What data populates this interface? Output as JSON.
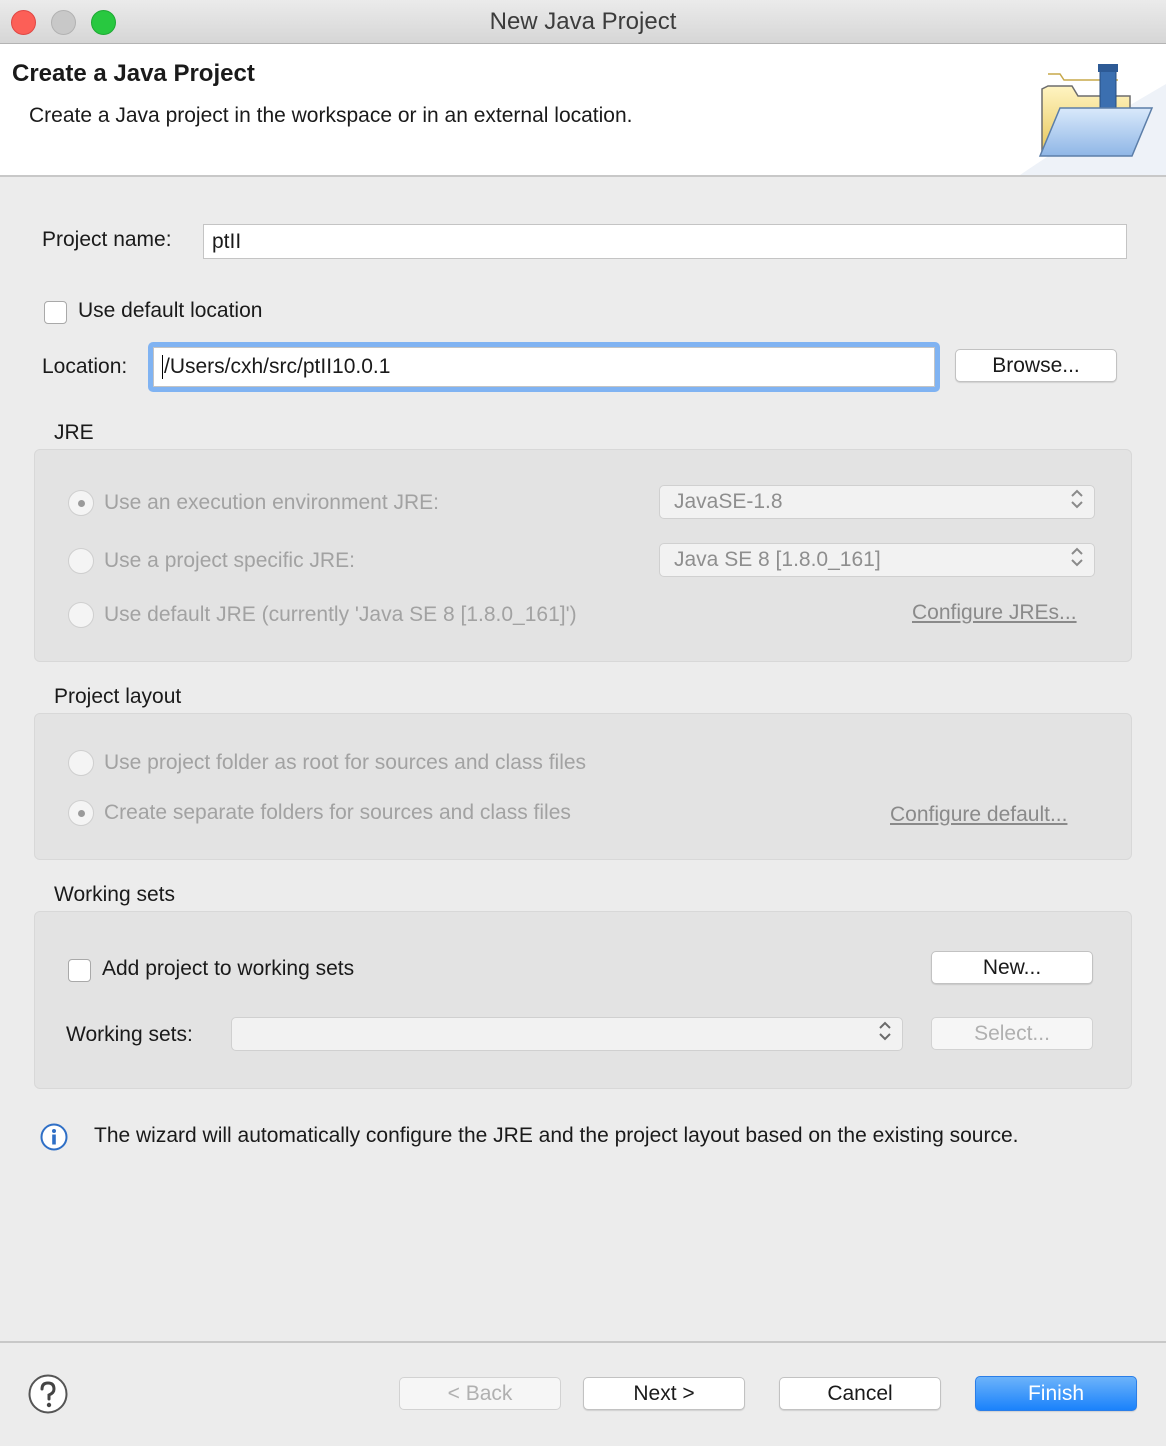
{
  "window": {
    "title": "New Java Project"
  },
  "header": {
    "title": "Create a Java Project",
    "description": "Create a Java project in the workspace or in an external location."
  },
  "project_name": {
    "label": "Project name:",
    "value": "ptII"
  },
  "default_location": {
    "label": "Use default location",
    "checked": false
  },
  "location": {
    "label": "Location:",
    "value": "/Users/cxh/src/ptII10.0.1",
    "browse_label": "Browse..."
  },
  "jre": {
    "group_label": "JRE",
    "option_env": "Use an execution environment JRE:",
    "option_specific": "Use a project specific JRE:",
    "option_default": "Use default JRE (currently 'Java SE 8 [1.8.0_161]')",
    "env_select": "JavaSE-1.8",
    "specific_select": "Java SE 8 [1.8.0_161]",
    "configure_link": "Configure JREs...",
    "selected": "option_env"
  },
  "layout": {
    "group_label": "Project layout",
    "option_root": "Use project folder as root for sources and class files",
    "option_separate": "Create separate folders for sources and class files",
    "configure_link": "Configure default...",
    "selected": "option_separate"
  },
  "working_sets": {
    "group_label": "Working sets",
    "add_label": "Add project to working sets",
    "add_checked": false,
    "new_button": "New...",
    "sets_label": "Working sets:",
    "sets_value": "",
    "select_button": "Select..."
  },
  "info": {
    "message": "The wizard will automatically configure the JRE and the project layout based on the existing source."
  },
  "footer": {
    "back": "< Back",
    "next": "Next >",
    "cancel": "Cancel",
    "finish": "Finish"
  },
  "icons": [
    "close-light-icon",
    "minimize-light-icon",
    "zoom-light-icon",
    "java-project-folder-icon",
    "info-icon",
    "help-icon",
    "up-down-arrows-icon"
  ],
  "colors": {
    "close": "#fc5f57",
    "minimize": "#c8c8c8",
    "zoom": "#28c840",
    "focus_ring": "#80b3f2",
    "finish_button": "#1a82fb"
  }
}
